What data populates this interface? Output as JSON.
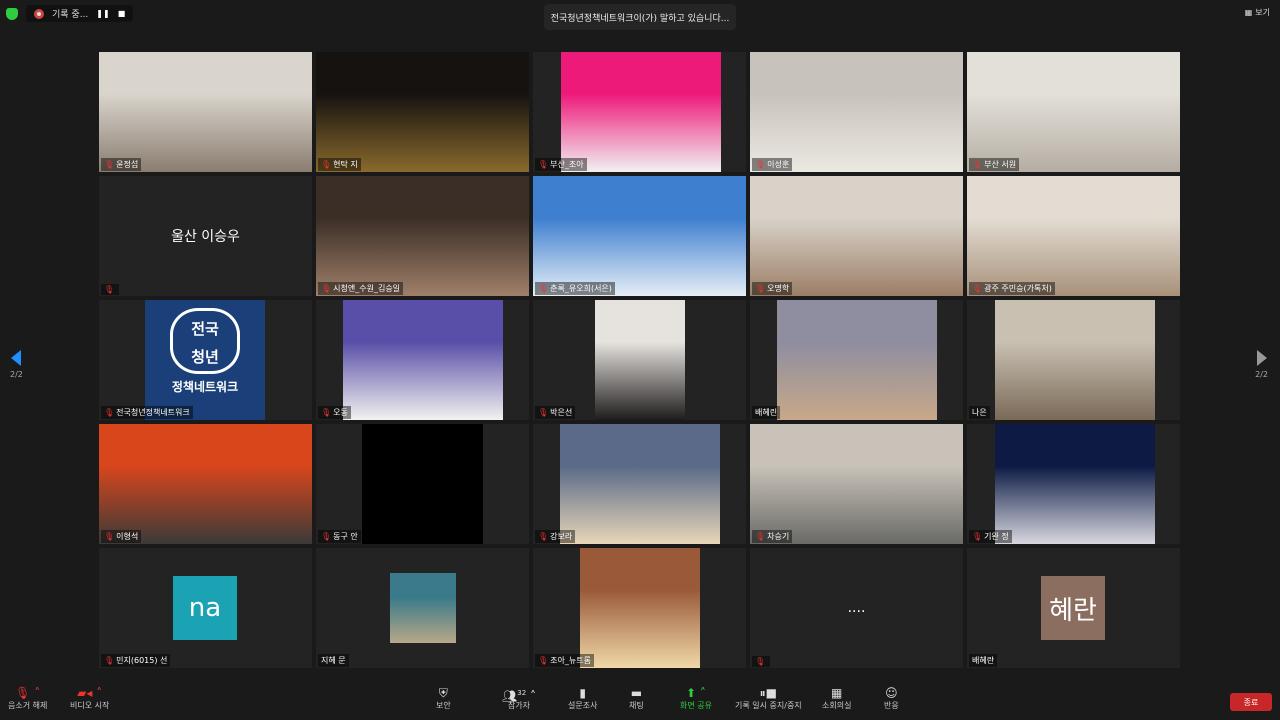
{
  "topbar": {
    "recording_label": "기록 중...",
    "pause": "❚❚",
    "stop": "■",
    "speaker": "전국청년정책네트워크이(가) 말하고 있습니다...",
    "view_label": "보기"
  },
  "nav": {
    "page": "2/2"
  },
  "tiles": [
    {
      "name": "윤정섭",
      "bg": [
        "#d9d4cc",
        "#8a7d70"
      ],
      "muted": true
    },
    {
      "name": "현탁 지",
      "bg": [
        "#151210",
        "#8a6a2c"
      ],
      "muted": true
    },
    {
      "name": "부산_조아",
      "bg": [
        "#ee1a7a",
        "#f2f2f2"
      ],
      "frame": [
        28,
        188
      ],
      "muted": true
    },
    {
      "name": "이성훈",
      "bg": [
        "#c8c2bc",
        "#ece8e2"
      ],
      "muted": true
    },
    {
      "name": "부산 서원",
      "bg": [
        "#e3e0da",
        "#b5ada2"
      ],
      "muted": true
    },
    {
      "big": "울산 이승우",
      "muted": true
    },
    {
      "name": "시청앤_수원_김승일",
      "bg": [
        "#3a2e26",
        "#a0806a"
      ],
      "muted": true
    },
    {
      "name": "춘록_유오희(서은)",
      "bg": [
        "#3f7fd0",
        "#e6eef6"
      ],
      "muted": true
    },
    {
      "name": "오명학",
      "bg": [
        "#d8d2c8",
        "#9c7e66"
      ],
      "muted": true
    },
    {
      "name": "광주 주민승(가톡처)",
      "bg": [
        "#e2dcd2",
        "#a8917a"
      ],
      "muted": true
    },
    {
      "name": "전국청년정책네트워크",
      "bg": [
        "#1b3f78",
        "#1b3f78"
      ],
      "frame": [
        46,
        166
      ],
      "logo": [
        "전국",
        "청년",
        "정책네트워크"
      ],
      "muted": true
    },
    {
      "name": "오동",
      "bg": [
        "#5a4fa8",
        "#f2f2f0"
      ],
      "frame": [
        27,
        187
      ],
      "muted": true
    },
    {
      "name": "박은선",
      "bg": [
        "#e6e2de",
        "#1e1c1c"
      ],
      "frame": [
        62,
        152
      ],
      "muted": true
    },
    {
      "name": "배혜린",
      "bg": [
        "#8e8ea0",
        "#c8a888"
      ],
      "frame": [
        27,
        187
      ],
      "muted": false
    },
    {
      "name": "나은",
      "bg": [
        "#c9c0b2",
        "#7a6a58"
      ],
      "frame": [
        28,
        188
      ],
      "muted": false
    },
    {
      "name": "이형석",
      "bg": [
        "#d8461c",
        "#3a3a38"
      ],
      "muted": true
    },
    {
      "name": "동구 안",
      "bg": [
        "#000000",
        "#000000"
      ],
      "frame": [
        46,
        167
      ],
      "muted": true
    },
    {
      "name": "강보라",
      "bg": [
        "#5a6a88",
        "#e8d6b8"
      ],
      "frame": [
        27,
        187
      ],
      "muted": true
    },
    {
      "name": "차승기",
      "bg": [
        "#c8c2b8",
        "#6a6a66"
      ],
      "muted": true
    },
    {
      "name": "기완 정",
      "bg": [
        "#0c1a44",
        "#d8d8e0"
      ],
      "frame": [
        28,
        188
      ],
      "muted": true
    },
    {
      "name": "민지(6015) 선",
      "avatar": "na",
      "avatar_color": "#1ba3b3",
      "muted": true
    },
    {
      "name": "지혜 문",
      "bg": [
        "#3a7a8a",
        "#b8a888"
      ],
      "frame": [
        74,
        140
      ],
      "small": true,
      "muted": false
    },
    {
      "name": "조아_뉴트롬",
      "bg": [
        "#9a5a3a",
        "#f0d8a8"
      ],
      "frame": [
        47,
        167
      ],
      "muted": true
    },
    {
      "dots": "....",
      "muted": true,
      "name": ""
    },
    {
      "name": "배혜란",
      "avatar": "혜란",
      "avatar_color": "#8b6e60",
      "muted": false
    }
  ],
  "toolbar": {
    "mute": "음소거 해제",
    "video": "비디오 시작",
    "security": "보안",
    "participants": "참가자",
    "participant_count": "32",
    "polls": "설문조사",
    "chat": "채팅",
    "share": "화면 공유",
    "record": "기록 일시 중지/중지",
    "breakout": "소회의실",
    "reactions": "반응",
    "end": "종료"
  }
}
